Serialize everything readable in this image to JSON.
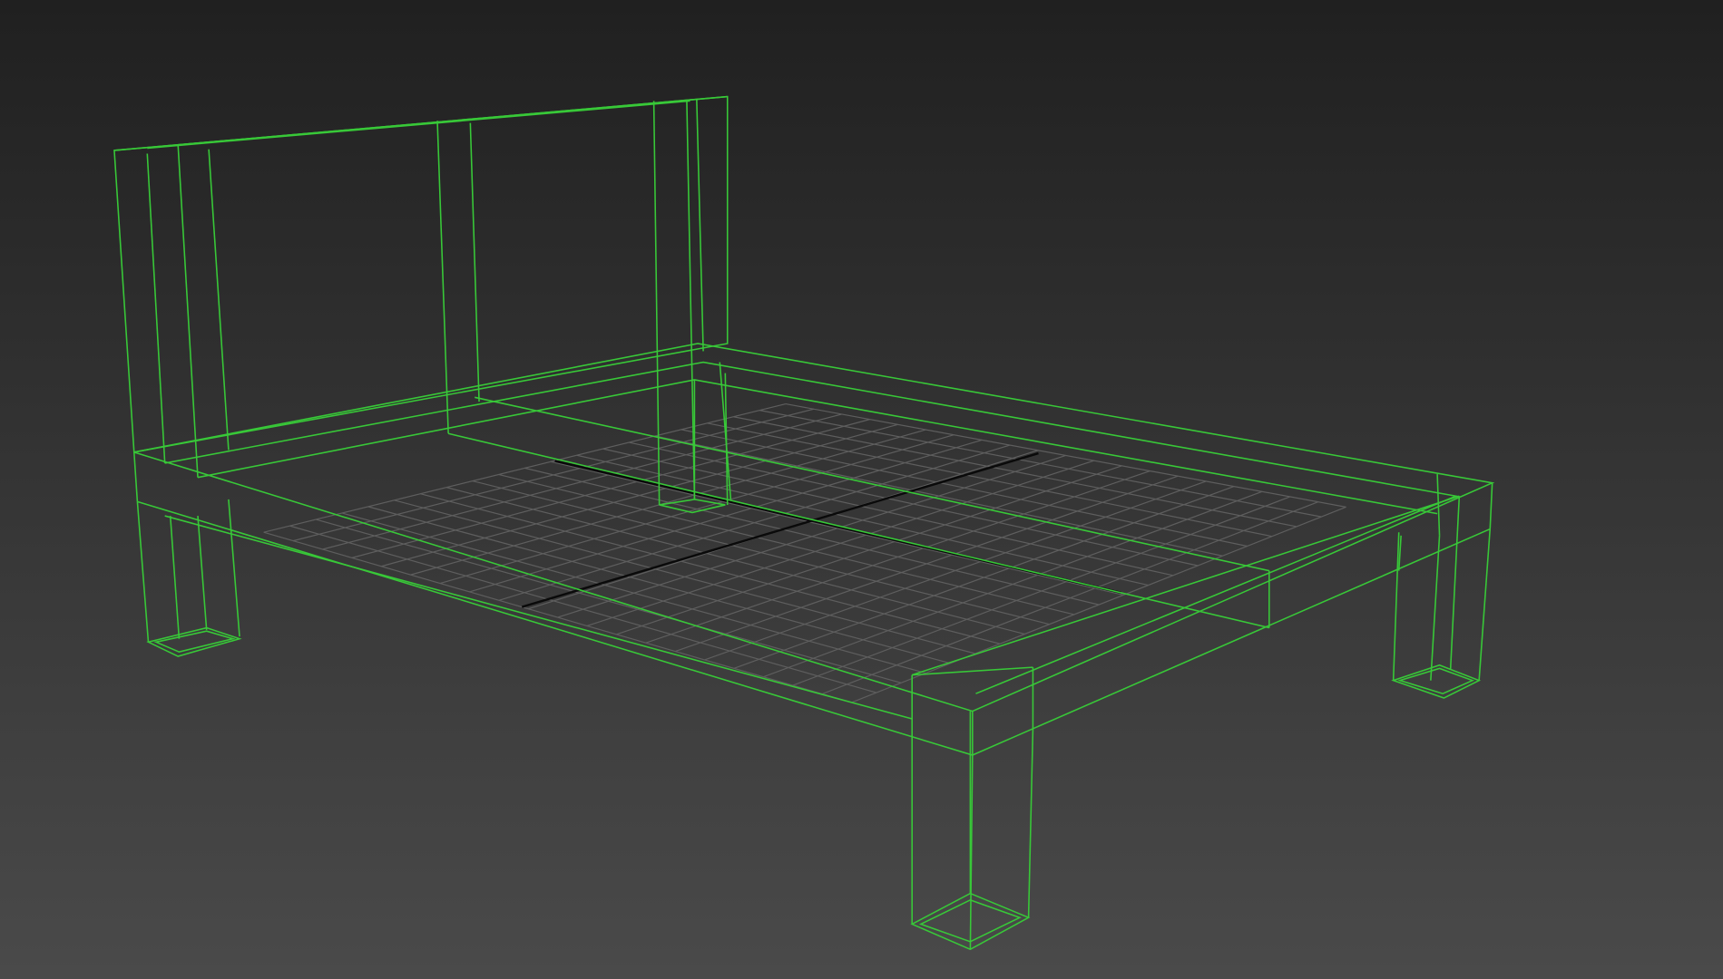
{
  "viewport": {
    "mode": "wireframe",
    "background_top": "#202020",
    "background_bottom": "#4a4a4a",
    "grid_color": "#5e5e5e",
    "axis_color": "#0a0a0a",
    "wireframe_color": "#38c838"
  },
  "scene": {
    "objects": [
      {
        "name": "bed-frame"
      },
      {
        "name": "headboard"
      },
      {
        "name": "leg-front-left"
      },
      {
        "name": "leg-front-right"
      },
      {
        "name": "leg-back-left"
      },
      {
        "name": "leg-back-right"
      }
    ]
  }
}
